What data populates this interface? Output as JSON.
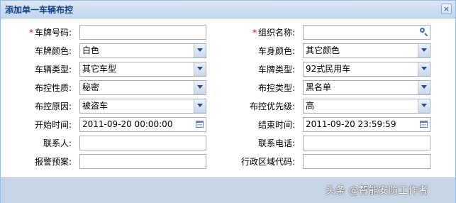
{
  "dialog": {
    "title": "添加单一车辆布控",
    "close_glyph": "×"
  },
  "form": {
    "plate_number": {
      "label": "车牌号码:",
      "required_mark": "*",
      "value": ""
    },
    "org_name": {
      "label": "组织名称:",
      "required_mark": "*",
      "value": "",
      "icon": "search-icon"
    },
    "plate_color": {
      "label": "车牌颜色:",
      "value": "白色"
    },
    "body_color": {
      "label": "车身颜色:",
      "value": "其它颜色"
    },
    "vehicle_type": {
      "label": "车辆类型:",
      "value": "其它车型"
    },
    "plate_type": {
      "label": "车牌类型:",
      "value": "92式民用车"
    },
    "control_nature": {
      "label": "布控性质:",
      "value": "秘密"
    },
    "control_type": {
      "label": "布控类型:",
      "value": "黑名单"
    },
    "control_reason": {
      "label": "布控原因:",
      "value": "被盗车"
    },
    "control_priority": {
      "label": "布控优先级:",
      "value": "高"
    },
    "start_time": {
      "label": "开始时间:",
      "value": "2011-09-20 00:00:00",
      "icon": "calendar-icon"
    },
    "end_time": {
      "label": "结束时间:",
      "value": "2011-09-20 23:59:59",
      "icon": "calendar-icon"
    },
    "contact_person": {
      "label": "联系人:",
      "value": ""
    },
    "contact_phone": {
      "label": "联系电话:",
      "value": ""
    },
    "alarm_plan": {
      "label": "报警预案:",
      "value": ""
    },
    "region_code": {
      "label": "行政区域代码:",
      "value": ""
    }
  },
  "watermark": "头条 @智能安防工作者",
  "colors": {
    "title_text": "#15428b",
    "required": "#d00000",
    "footer_bg": "#c5d4e6",
    "border": "#99bbe8"
  }
}
